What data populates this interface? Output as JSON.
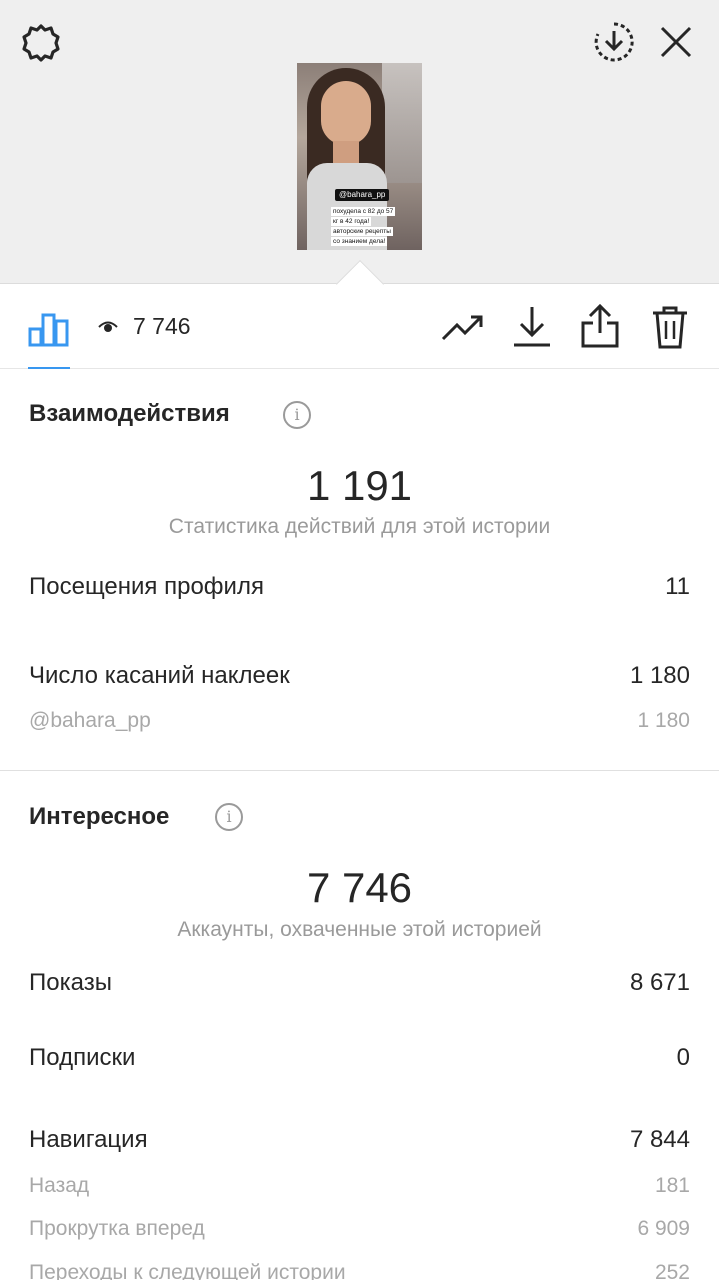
{
  "story": {
    "tag": "@bahara_pp",
    "caption_lines": [
      "похудела с 82 до 57",
      "кг в 42 года!",
      "авторские рецепты",
      "со знанием дела!"
    ]
  },
  "toolbar": {
    "views_count": "7 746"
  },
  "interactions": {
    "title": "Взаимодействия",
    "total": "1 191",
    "caption": "Статистика действий для этой истории",
    "rows": [
      {
        "label": "Посещения профиля",
        "value": "11"
      },
      {
        "label": "Число касаний наклеек",
        "value": "1 180"
      }
    ],
    "sub_rows": [
      {
        "label": "@bahara_pp",
        "value": "1 180"
      }
    ]
  },
  "discovery": {
    "title": "Интересное",
    "total": "7 746",
    "caption": "Аккаунты, охваченные этой историей",
    "rows": [
      {
        "label": "Показы",
        "value": "8 671"
      },
      {
        "label": "Подписки",
        "value": "0"
      },
      {
        "label": "Навигация",
        "value": "7 844"
      }
    ],
    "sub_rows": [
      {
        "label": "Назад",
        "value": "181"
      },
      {
        "label": "Прокрутка вперед",
        "value": "6 909"
      },
      {
        "label": "Переходы к следующей истории",
        "value": "252"
      }
    ]
  },
  "colors": {
    "accent": "#3897f0",
    "text": "#262626",
    "muted": "#9a9a9a",
    "top_bg": "#efefef"
  },
  "icons": [
    "gear-icon",
    "download-circle-icon",
    "close-icon",
    "bar-chart-icon",
    "eye-icon",
    "trend-icon",
    "download-icon",
    "share-icon",
    "trash-icon",
    "info-icon"
  ]
}
